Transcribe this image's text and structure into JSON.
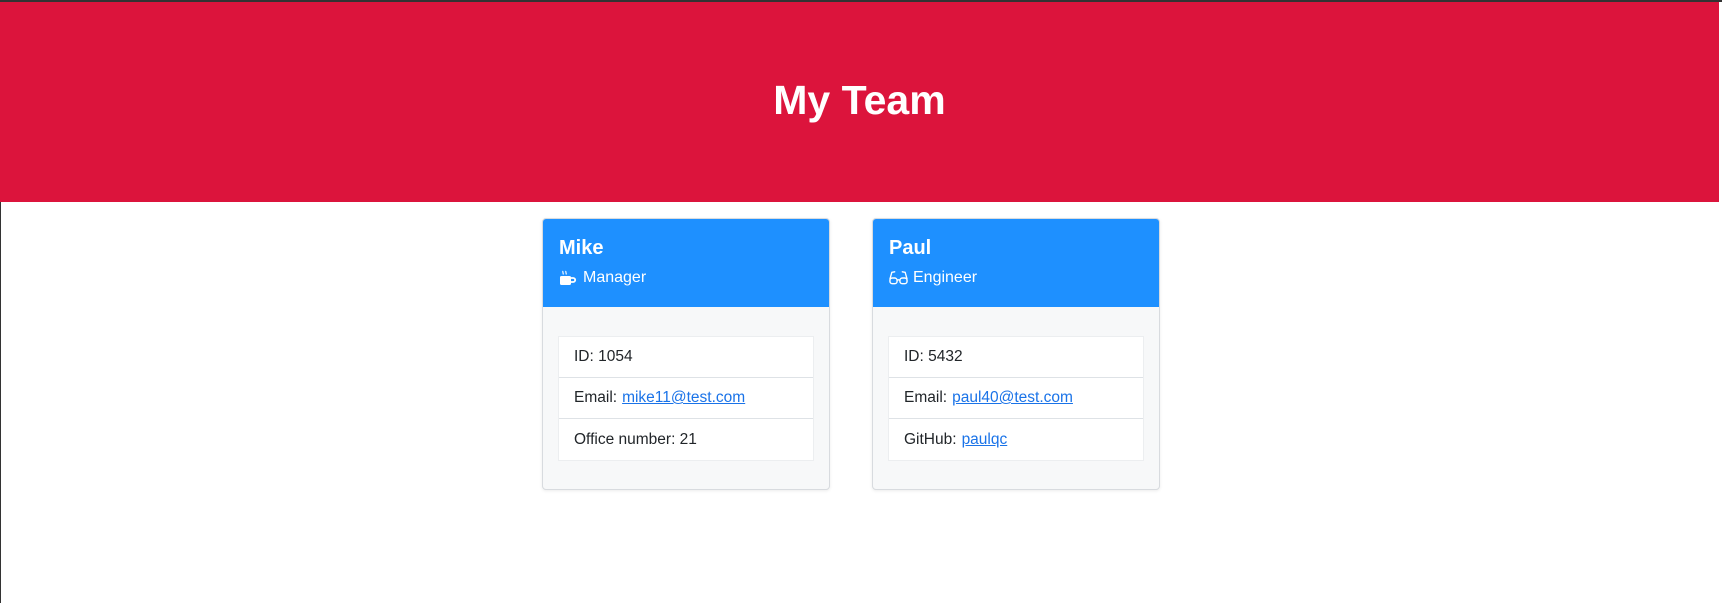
{
  "header": {
    "title": "My Team",
    "background_color": "#dc143c"
  },
  "cards": [
    {
      "name": "Mike",
      "role": "Manager",
      "role_icon": "mug-icon",
      "header_color": "#1e90ff",
      "id_text": "ID: 1054",
      "email_label": "Email:",
      "email": "mike11@test.com",
      "extra_text": "Office number: 21"
    },
    {
      "name": "Paul",
      "role": "Engineer",
      "role_icon": "glasses-icon",
      "header_color": "#1e90ff",
      "id_text": "ID: 5432",
      "email_label": "Email:",
      "email": "paul40@test.com",
      "github_label": "GitHub:",
      "github": "paulqc"
    }
  ]
}
